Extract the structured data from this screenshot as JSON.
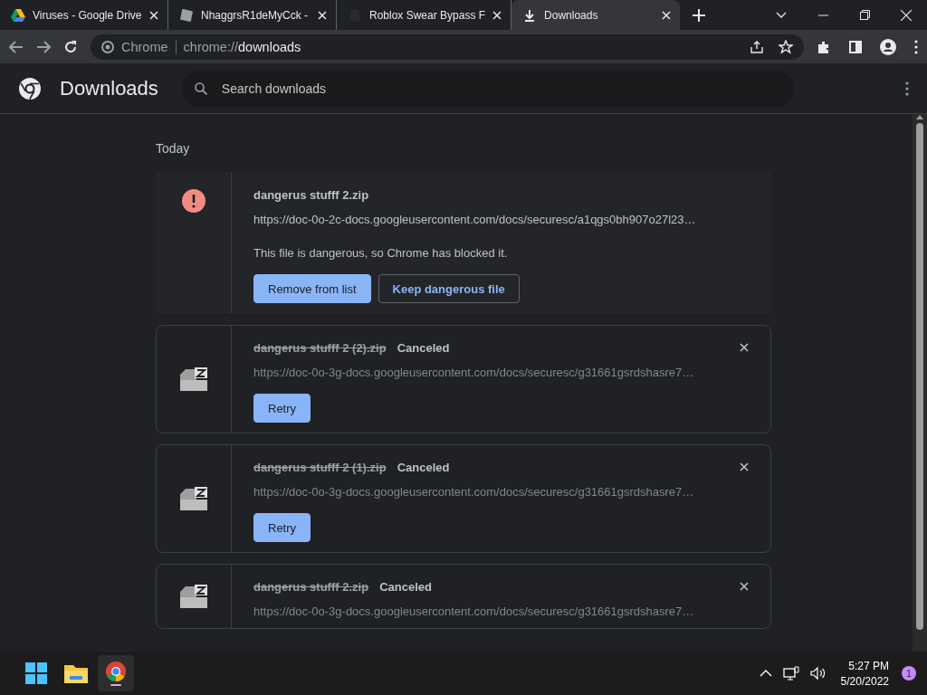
{
  "tabs": [
    {
      "title": "Viruses - Google Drive",
      "selected": false
    },
    {
      "title": "NhaggrsR1deMyCck -",
      "selected": false
    },
    {
      "title": "Roblox Swear Bypass F",
      "selected": false
    },
    {
      "title": "Downloads",
      "selected": true
    }
  ],
  "omnibox": {
    "site": "Chrome",
    "url_prefix": "chrome://",
    "url_host": "downloads"
  },
  "header": {
    "title": "Downloads",
    "search_placeholder": "Search downloads"
  },
  "section": "Today",
  "downloads": [
    {
      "kind": "dangerous",
      "name": "dangerus stufff 2.zip",
      "url": "https://doc-0o-2c-docs.googleusercontent.com/docs/securesc/a1qgs0bh907o27l23…",
      "message": "This file is dangerous, so Chrome has blocked it.",
      "buttons": [
        {
          "label": "Remove from list",
          "primary": true
        },
        {
          "label": "Keep dangerous file",
          "primary": false
        }
      ]
    },
    {
      "kind": "canceled",
      "name": "dangerus stufff 2 (2).zip",
      "status": "Canceled",
      "url": "https://doc-0o-3g-docs.googleusercontent.com/docs/securesc/g31661gsrdshasre7…",
      "buttons": [
        {
          "label": "Retry",
          "primary": true
        }
      ]
    },
    {
      "kind": "canceled",
      "name": "dangerus stufff 2 (1).zip",
      "status": "Canceled",
      "url": "https://doc-0o-3g-docs.googleusercontent.com/docs/securesc/g31661gsrdshasre7…",
      "buttons": [
        {
          "label": "Retry",
          "primary": true
        }
      ]
    },
    {
      "kind": "canceled",
      "name": "dangerus stufff 2.zip",
      "status": "Canceled",
      "url": "https://doc-0o-3g-docs.googleusercontent.com/docs/securesc/g31661gsrdshasre7…"
    }
  ],
  "taskbar": {
    "time": "5:27 PM",
    "date": "5/20/2022",
    "notifications": "1"
  }
}
